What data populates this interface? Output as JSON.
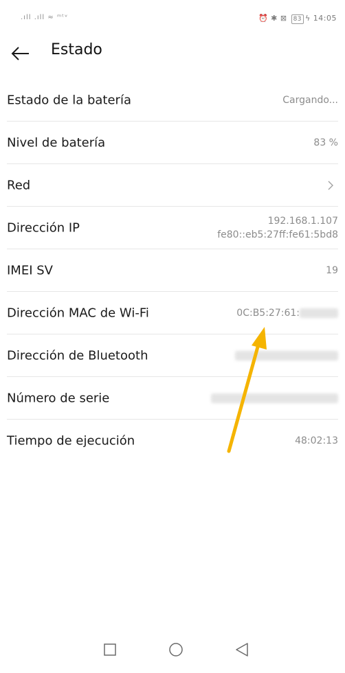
{
  "status_bar": {
    "left_text": ".ıll .ıll ≈ ᵐᵗᵛ",
    "right_icons": "⏰ ✱ ⊠",
    "battery": "83",
    "time": "14:05"
  },
  "header": {
    "title": "Estado"
  },
  "rows": [
    {
      "label": "Estado de la batería",
      "value": "Cargando..."
    },
    {
      "label": "Nivel de batería",
      "value": "83 %"
    },
    {
      "label": "Red",
      "value": ""
    },
    {
      "label": "Dirección IP",
      "value_line1": "192.168.1.107",
      "value_line2": "fe80::eb5:27ff:fe61:5bd8"
    },
    {
      "label": "IMEI SV",
      "value": "19"
    },
    {
      "label": "Dirección MAC de Wi-Fi",
      "value": "0C:B5:27:61:"
    },
    {
      "label": "Dirección de Bluetooth",
      "value": ""
    },
    {
      "label": "Número de serie",
      "value": ""
    },
    {
      "label": "Tiempo de ejecución",
      "value": "48:02:13"
    }
  ],
  "colors": {
    "arrow": "#F5B400",
    "divider": "#e6e6e6",
    "value_text": "#8c8c8c"
  },
  "icons": {
    "back": "arrow-left-icon",
    "chevron": "chevron-right-icon",
    "recent_apps": "square-icon",
    "home": "circle-icon",
    "back_nav": "triangle-back-icon"
  }
}
